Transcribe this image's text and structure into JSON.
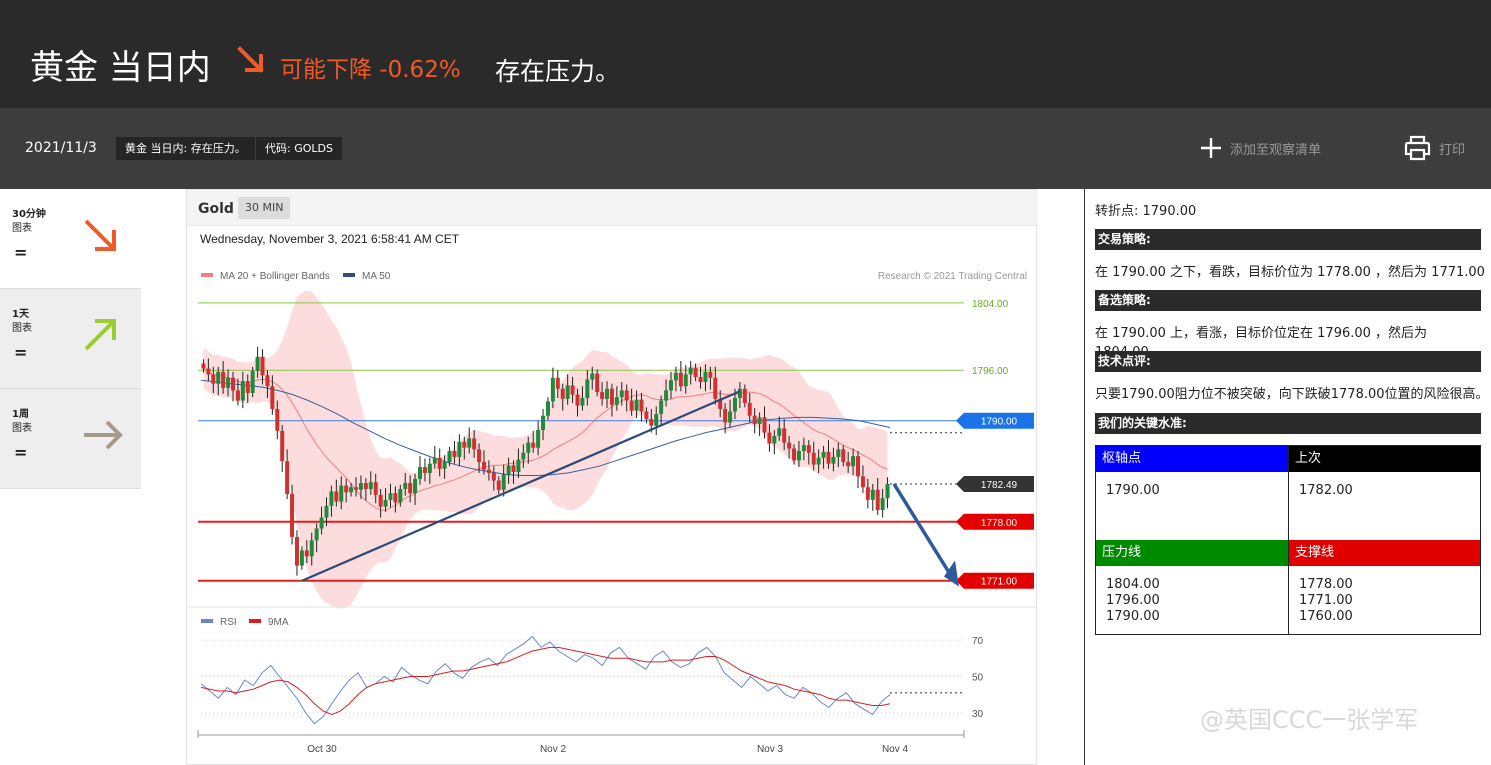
{
  "header": {
    "title": "黄金 当日内",
    "direction": "可能下降 -0.62%",
    "headline": "存在压力。",
    "date": "2021/11/3",
    "chip_title": "黄金 当日内: 存在压力。",
    "chip_code": "代码: GOLDS",
    "watchlist": "添加至观察清单",
    "print": "打印"
  },
  "timeframes": [
    {
      "label_bold": "30分钟",
      "label": "图表",
      "sign": "=",
      "direction": "down",
      "icon": "arrow-down-right-icon"
    },
    {
      "label_bold": "1天",
      "label": "图表",
      "sign": "=",
      "direction": "up",
      "icon": "arrow-up-right-icon"
    },
    {
      "label_bold": "1周",
      "label": "图表",
      "sign": "=",
      "direction": "flat",
      "icon": "arrow-right-icon"
    }
  ],
  "colors": {
    "down": "#f05a28",
    "up": "#9acd32",
    "flat": "#a89a8a",
    "resistance": "#008a00",
    "support": "#e00000",
    "pivot": "#0000ff",
    "last": "#000000"
  },
  "chart": {
    "instrument": "Gold",
    "timeframe": "30 MIN",
    "datetime": "Wednesday, November 3, 2021 6:58:41 AM CET",
    "legend_bb": "MA 20 + Bollinger Bands",
    "legend_ma50": "MA 50",
    "credit": "Research © 2021 Trading Central",
    "legend_rsi": "RSI",
    "legend_9ma": "9MA"
  },
  "chart_data": {
    "type": "candlestick",
    "instrument": "Gold",
    "timeframe": "30 MIN",
    "x_tick_labels": [
      "Oct 30",
      "Nov 2",
      "Nov 3",
      "Nov 4"
    ],
    "price_axis": {
      "ylim": [
        1768,
        1806
      ]
    },
    "levels": [
      {
        "value": 1804.0,
        "label": "1804.00",
        "kind": "resistance",
        "color": "#8bc34a"
      },
      {
        "value": 1796.0,
        "label": "1796.00",
        "kind": "resistance",
        "color": "#8bc34a"
      },
      {
        "value": 1790.0,
        "label": "1790.00",
        "kind": "pivot",
        "color": "#3e7fe0"
      },
      {
        "value": 1782.49,
        "label": "1782.49",
        "kind": "last",
        "color": "#333333"
      },
      {
        "value": 1778.0,
        "label": "1778.00",
        "kind": "support",
        "color": "#e02020"
      },
      {
        "value": 1771.0,
        "label": "1771.00",
        "kind": "support",
        "color": "#e02020"
      }
    ],
    "close_series": [
      1796.2,
      1795.5,
      1794.4,
      1795.8,
      1793.9,
      1795.1,
      1793.6,
      1792.4,
      1794.7,
      1793.3,
      1795.9,
      1797.6,
      1795.4,
      1794.1,
      1791.4,
      1788.8,
      1785.2,
      1781.3,
      1776.2,
      1772.8,
      1774.6,
      1773.9,
      1775.8,
      1777.2,
      1778.5,
      1779.9,
      1781.6,
      1780.4,
      1782.3,
      1781.5,
      1782.1,
      1781.8,
      1782.6,
      1781.9,
      1782.7,
      1781.2,
      1779.8,
      1780.6,
      1781.4,
      1780.3,
      1781.9,
      1782.6,
      1781.4,
      1783.1,
      1784.5,
      1783.8,
      1784.9,
      1785.6,
      1784.3,
      1785.1,
      1786.4,
      1785.7,
      1787.5,
      1786.8,
      1787.9,
      1786.6,
      1785.1,
      1784.2,
      1783.8,
      1782.9,
      1781.8,
      1783.6,
      1784.7,
      1783.9,
      1785.4,
      1786.2,
      1787.4,
      1786.8,
      1788.9,
      1790.6,
      1792.3,
      1795.1,
      1793.8,
      1792.6,
      1794.2,
      1793.1,
      1791.8,
      1792.7,
      1794.9,
      1795.6,
      1793.4,
      1792.6,
      1793.8,
      1791.9,
      1792.8,
      1793.6,
      1792.4,
      1791.2,
      1792.5,
      1791.1,
      1790.2,
      1789.4,
      1790.8,
      1792.4,
      1793.6,
      1794.8,
      1795.7,
      1794.1,
      1795.5,
      1796.3,
      1795.2,
      1794.6,
      1795.8,
      1795.1,
      1792.6,
      1791.4,
      1789.8,
      1791.1,
      1792.7,
      1793.8,
      1792.1,
      1790.6,
      1789.6,
      1790.4,
      1788.6,
      1787.3,
      1788.2,
      1789.1,
      1787.4,
      1786.7,
      1785.3,
      1786.4,
      1787.1,
      1786.2,
      1784.8,
      1785.6,
      1786.3,
      1784.9,
      1785.7,
      1786.6,
      1785.1,
      1784.6,
      1785.8,
      1783.4,
      1782.1,
      1780.6,
      1781.8,
      1779.4,
      1780.8,
      1782.5
    ],
    "ma50": {
      "name": "MA 50",
      "values": [
        1794.8,
        1794.6,
        1794.4,
        1794.2,
        1794.0,
        1793.6,
        1793.1,
        1792.4,
        1791.6,
        1790.7,
        1789.7,
        1788.8,
        1787.9,
        1787.1,
        1786.4,
        1785.7,
        1785.1,
        1784.6,
        1784.2,
        1783.9,
        1783.6,
        1783.5,
        1783.5,
        1783.6,
        1783.8,
        1784.2,
        1784.6,
        1785.2,
        1785.8,
        1786.4,
        1787.0,
        1787.6,
        1788.1,
        1788.6,
        1789.0,
        1789.4,
        1789.8,
        1790.1,
        1790.3,
        1790.4,
        1790.4,
        1790.3,
        1790.2,
        1790.0,
        1789.6,
        1789.2
      ]
    },
    "rsi_panel": {
      "ylim": [
        20,
        75
      ],
      "tick_labels": [
        "70",
        "50",
        "30"
      ],
      "series": [
        {
          "name": "RSI",
          "values": [
            46,
            42,
            38,
            44,
            40,
            48,
            45,
            52,
            56,
            50,
            44,
            38,
            30,
            24,
            28,
            35,
            42,
            48,
            52,
            44,
            46,
            50,
            47,
            55,
            51,
            48,
            46,
            53,
            57,
            52,
            49,
            55,
            58,
            60,
            56,
            62,
            65,
            68,
            72,
            66,
            69,
            64,
            61,
            58,
            62,
            60,
            56,
            63,
            66,
            60,
            57,
            54,
            61,
            64,
            58,
            55,
            57,
            63,
            66,
            61,
            52,
            48,
            44,
            50,
            46,
            42,
            45,
            40,
            38,
            44,
            41,
            36,
            33,
            38,
            41,
            35,
            32,
            29,
            36,
            40
          ]
        },
        {
          "name": "9MA",
          "values": [
            44,
            43,
            42,
            42,
            41,
            42,
            43,
            45,
            47,
            48,
            47,
            44,
            40,
            35,
            31,
            29,
            31,
            35,
            40,
            44,
            46,
            47,
            48,
            49,
            50,
            50,
            50,
            51,
            52,
            53,
            53,
            54,
            55,
            56,
            57,
            58,
            60,
            62,
            64,
            65,
            66,
            66,
            65,
            64,
            63,
            62,
            61,
            60,
            60,
            60,
            59,
            58,
            58,
            58,
            59,
            59,
            59,
            60,
            61,
            61,
            59,
            56,
            53,
            51,
            49,
            47,
            46,
            45,
            43,
            42,
            41,
            40,
            38,
            37,
            37,
            36,
            35,
            34,
            34,
            35
          ]
        }
      ]
    }
  },
  "panel": {
    "pivot_line": "转折点: 1790.00",
    "strategy_head": "交易策略:",
    "strategy_text": "在 1790.00 之下，看跌，目标价位为 1778.00 ，然后为 1771.00 。",
    "alt_head": "备选策略:",
    "alt_text": "在 1790.00 上，看涨，目标价位定在 1796.00 ，然后为 1804.00。",
    "comment_head": "技术点评:",
    "comment_text": "只要1790.00阻力位不被突破，向下跌破1778.00位置的风险很高。",
    "levels_head": "我们的关键水准:",
    "table": {
      "pivot_head": "枢轴点",
      "pivot_value": "1790.00",
      "last_head": "上次",
      "last_value": "1782.00",
      "resistance_head": "压力线",
      "resistance_values": "1804.00\n1796.00\n1790.00",
      "support_head": "支撑线",
      "support_values": "1778.00\n1771.00\n1760.00"
    }
  },
  "watermark": "@英国CCC一张学军"
}
